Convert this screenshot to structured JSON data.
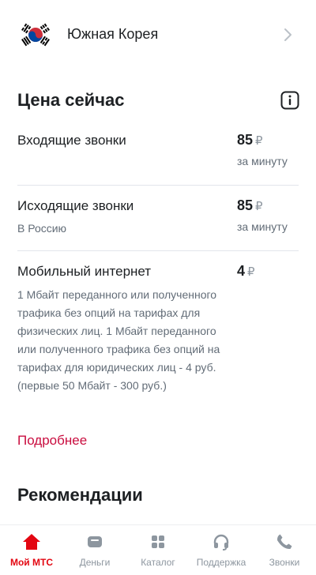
{
  "country": {
    "name": "Южная Корея"
  },
  "price_now": {
    "title": "Цена сейчас",
    "rates": [
      {
        "label": "Входящие звонки",
        "sub": "",
        "price": "85",
        "currency": "₽",
        "unit": "за минуту"
      },
      {
        "label": "Исходящие звонки",
        "sub": "В Россию",
        "price": "85",
        "currency": "₽",
        "unit": "за минуту"
      },
      {
        "label": "Мобильный интернет",
        "sub": "1 Мбайт переданного или полученного трафика без опций на тарифах для физических лиц. 1 Мбайт переданного или полученного трафика без опций на тарифах для юридических лиц - 4 руб. (первые 50 Мбайт - 300 руб.)",
        "price": "4",
        "currency": "₽",
        "unit": ""
      }
    ],
    "more_link": "Подробнее"
  },
  "recommendations": {
    "title": "Рекомендации"
  },
  "tabbar": {
    "items": [
      {
        "label": "Мой МТС",
        "icon": "home-icon",
        "active": true
      },
      {
        "label": "Деньги",
        "icon": "wallet-icon",
        "active": false
      },
      {
        "label": "Каталог",
        "icon": "catalog-icon",
        "active": false
      },
      {
        "label": "Поддержка",
        "icon": "headset-icon",
        "active": false
      },
      {
        "label": "Звонки",
        "icon": "phone-icon",
        "active": false
      }
    ]
  },
  "colors": {
    "accent": "#e30611",
    "link": "#c90d3f",
    "text": "#1d2023",
    "secondary": "#626c77"
  }
}
